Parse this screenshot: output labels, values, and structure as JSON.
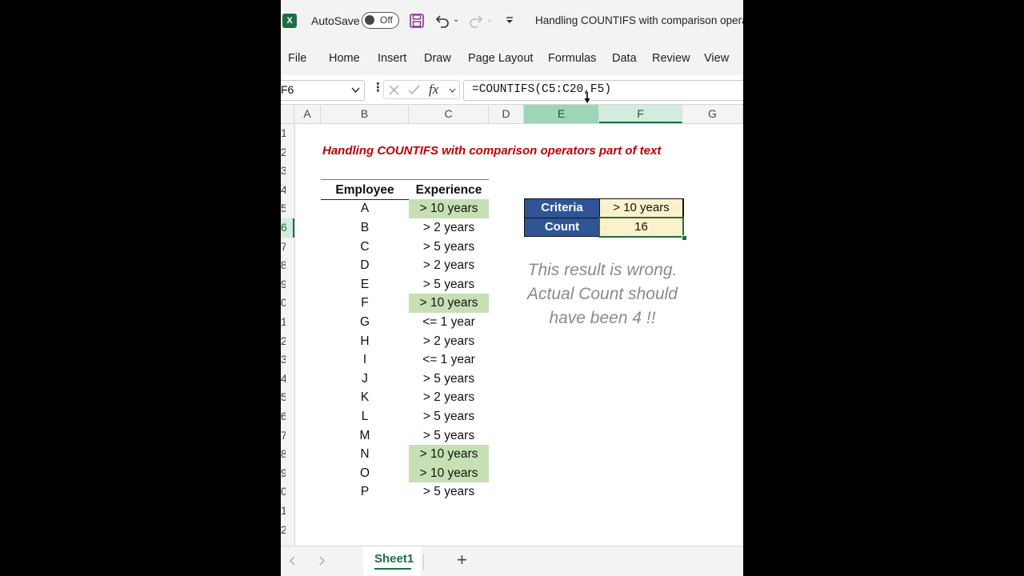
{
  "titlebar": {
    "autosave_label": "AutoSave",
    "toggle_state": "Off",
    "document_title": "Handling COUNTIFS with comparison operat"
  },
  "ribbon": {
    "tabs": [
      "File",
      "Home",
      "Insert",
      "Draw",
      "Page Layout",
      "Formulas",
      "Data",
      "Review",
      "View"
    ]
  },
  "formula_bar": {
    "name_box": "F6",
    "formula": "=COUNTIFS(C5:C20,F5)"
  },
  "columns": [
    "A",
    "B",
    "C",
    "D",
    "E",
    "F",
    "G"
  ],
  "row_numbers": [
    "1",
    "2",
    "3",
    "4",
    "5",
    "6",
    "7",
    "8",
    "9",
    "0",
    "1",
    "2",
    "3",
    "4",
    "5",
    "6",
    "7",
    "8",
    "9",
    "0",
    "1",
    "2"
  ],
  "sheet": {
    "heading": "Handling COUNTIFS with comparison operators part of text",
    "table_headers": {
      "employee": "Employee",
      "experience": "Experience"
    },
    "rows": [
      {
        "employee": "A",
        "experience": "> 10 years",
        "highlight": true
      },
      {
        "employee": "B",
        "experience": "> 2 years",
        "highlight": false
      },
      {
        "employee": "C",
        "experience": "> 5 years",
        "highlight": false
      },
      {
        "employee": "D",
        "experience": "> 2 years",
        "highlight": false
      },
      {
        "employee": "E",
        "experience": "> 5 years",
        "highlight": false
      },
      {
        "employee": "F",
        "experience": "> 10 years",
        "highlight": true
      },
      {
        "employee": "G",
        "experience": "<= 1 year",
        "highlight": false
      },
      {
        "employee": "H",
        "experience": "> 2 years",
        "highlight": false
      },
      {
        "employee": "I",
        "experience": "<= 1 year",
        "highlight": false
      },
      {
        "employee": "J",
        "experience": "> 5 years",
        "highlight": false
      },
      {
        "employee": "K",
        "experience": "> 2 years",
        "highlight": false
      },
      {
        "employee": "L",
        "experience": "> 5 years",
        "highlight": false
      },
      {
        "employee": "M",
        "experience": "> 5 years",
        "highlight": false
      },
      {
        "employee": "N",
        "experience": "> 10 years",
        "highlight": true
      },
      {
        "employee": "O",
        "experience": "> 10 years",
        "highlight": true
      },
      {
        "employee": "P",
        "experience": "> 5 years",
        "highlight": false
      }
    ],
    "criteria_label": "Criteria",
    "criteria_value": "> 10 years",
    "count_label": "Count",
    "count_value": "16",
    "note_lines": [
      "This result is wrong.",
      "Actual Count should",
      "have been 4 !!"
    ]
  },
  "sheet_tabs": {
    "active": "Sheet1",
    "add_label": "+"
  },
  "colors": {
    "excel_green": "#1d6f42",
    "highlight_green": "#c6e0b4",
    "header_blue": "#2f5597",
    "value_cream": "#fdf1cc",
    "heading_red": "#c00000"
  }
}
